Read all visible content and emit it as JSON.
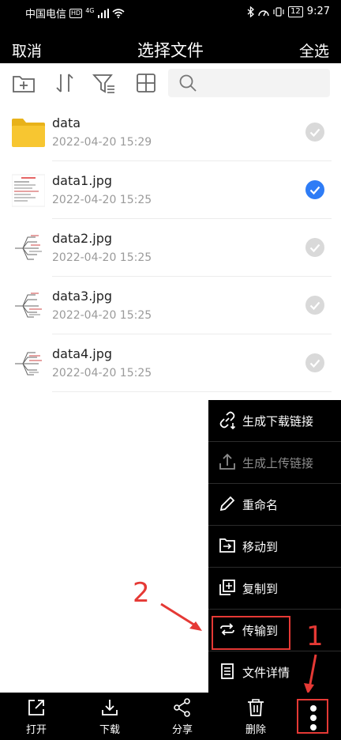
{
  "status_bar": {
    "carrier": "中国电信",
    "hd_badge": "HD",
    "network": "4G",
    "battery": "12",
    "time": "9:27"
  },
  "title_bar": {
    "cancel_label": "取消",
    "title": "选择文件",
    "select_all_label": "全选"
  },
  "toolbar": {
    "icons": [
      "new-folder-icon",
      "sort-icon",
      "filter-icon",
      "grid-view-icon",
      "search-icon"
    ]
  },
  "files": [
    {
      "name": "data",
      "date": "2022-04-20 15:29",
      "type": "folder",
      "selected": false
    },
    {
      "name": "data1.jpg",
      "date": "2022-04-20 15:25",
      "type": "image",
      "selected": true
    },
    {
      "name": "data2.jpg",
      "date": "2022-04-20 15:25",
      "type": "image",
      "selected": false
    },
    {
      "name": "data3.jpg",
      "date": "2022-04-20 15:25",
      "type": "image",
      "selected": false
    },
    {
      "name": "data4.jpg",
      "date": "2022-04-20 15:25",
      "type": "image",
      "selected": false
    }
  ],
  "more_menu": [
    {
      "label": "生成下载链接",
      "icon": "link-icon",
      "enabled": true
    },
    {
      "label": "生成上传链接",
      "icon": "upload-icon",
      "enabled": false
    },
    {
      "label": "重命名",
      "icon": "pencil-icon",
      "enabled": true
    },
    {
      "label": "移动到",
      "icon": "move-icon",
      "enabled": true
    },
    {
      "label": "复制到",
      "icon": "copy-icon",
      "enabled": true
    },
    {
      "label": "传输到",
      "icon": "transfer-icon",
      "enabled": true
    },
    {
      "label": "文件详情",
      "icon": "details-icon",
      "enabled": true
    }
  ],
  "bottom_bar": [
    {
      "label": "打开",
      "icon": "open-icon"
    },
    {
      "label": "下载",
      "icon": "download-icon"
    },
    {
      "label": "分享",
      "icon": "share-icon"
    },
    {
      "label": "删除",
      "icon": "trash-icon"
    }
  ],
  "annotations": {
    "step1": "1",
    "step2": "2"
  },
  "colors": {
    "accent": "#2e7cf6",
    "annotation": "#e53935",
    "folder": "#f7c631"
  }
}
